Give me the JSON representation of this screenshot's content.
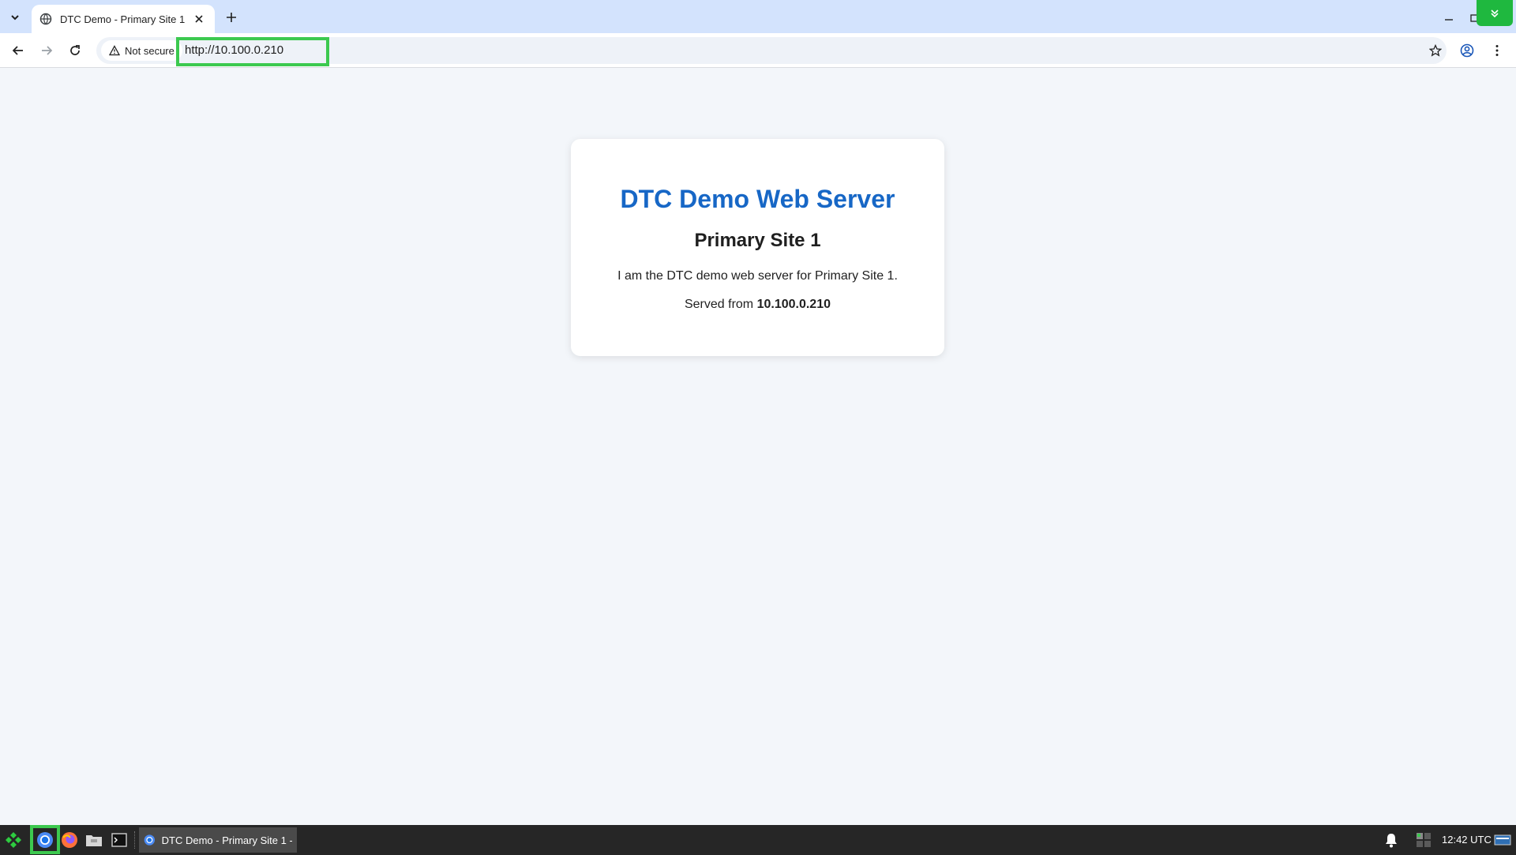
{
  "browser": {
    "tab": {
      "title": "DTC Demo - Primary Site 1"
    },
    "toolbar": {
      "security_label": "Not secure",
      "url": "http://10.100.0.210"
    }
  },
  "page": {
    "heading": "DTC Demo Web Server",
    "subheading": "Primary Site 1",
    "description": "I am the DTC demo web server for Primary Site 1.",
    "served_prefix": "Served from",
    "served_ip": "10.100.0.210"
  },
  "taskbar": {
    "window_label": "DTC Demo - Primary Site 1 - ...",
    "clock": "12:42 UTC"
  },
  "colors": {
    "accent_green": "#3cc94f",
    "heading_blue": "#1767c6",
    "tabstrip": "#d3e3fd",
    "taskbar": "#262626"
  }
}
